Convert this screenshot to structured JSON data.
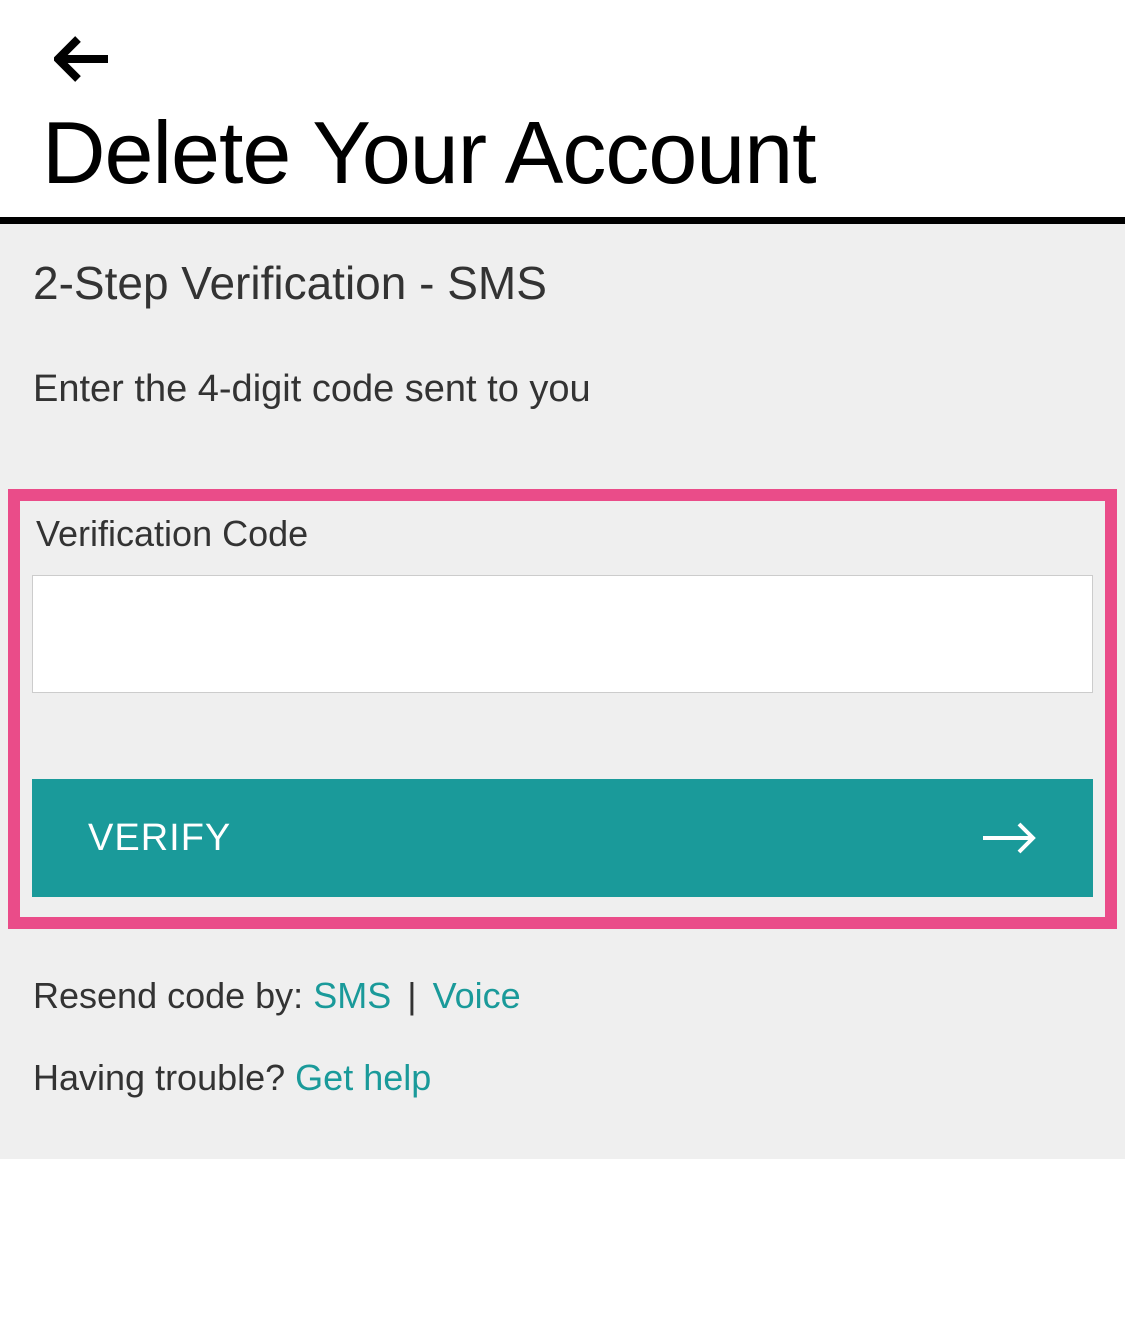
{
  "header": {
    "title": "Delete Your Account"
  },
  "main": {
    "subtitle": "2-Step Verification - SMS",
    "instruction": "Enter the 4-digit code sent to you",
    "field_label": "Verification Code",
    "input_value": "",
    "verify_label": "VERIFY"
  },
  "footer": {
    "resend_prefix": "Resend code by: ",
    "resend_sms": "SMS",
    "resend_divider": " | ",
    "resend_voice": "Voice",
    "trouble_prefix": "Having trouble? ",
    "trouble_link": "Get help"
  },
  "colors": {
    "accent": "#1a9a9a",
    "highlight": "#ea4c89"
  }
}
